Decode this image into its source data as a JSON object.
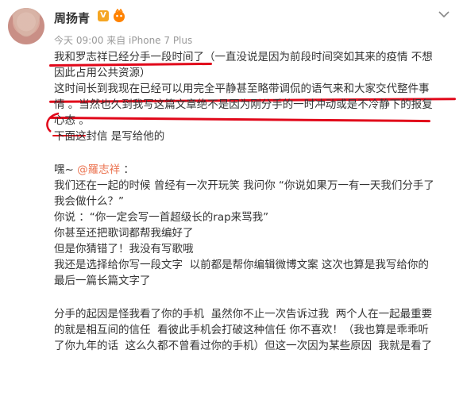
{
  "author": {
    "name": "周扬青",
    "verified_badge": "V",
    "time": "今天 09:00",
    "source": "来自 iPhone 7 Plus"
  },
  "post": {
    "p1_line1": "我和罗志祥已经分手一段时间了（一直没说是因为前段时间突如其来的疫情 不想",
    "p1_line2": "因此占用公共资源）",
    "p2_line1": "这时间长到我现在已经可以用完全平静甚至略带调侃的语气来和大家交代整件事",
    "p2_line2": "情 。当然也久到我写这篇文章绝不是因为刚分手的一时冲动或是不冷静下的报复",
    "p2_line3": "心态 。",
    "p3": "下面这封信 是写给他的",
    "greeting_prefix": "嘿~ ",
    "greeting_mention": "@羅志祥",
    "greeting_suffix": " ：",
    "p4_line1": "我们还在一起的时候 曾经有一次开玩笑 我问你 “你说如果万一有一天我们分手了",
    "p4_line2": "我会做什么？”",
    "p5": "你说 ：“你一定会写一首超级长的rap来骂我”",
    "p6": "你甚至还把歌词都帮我编好了",
    "p7": "但是你猜错了！我没有写歌哦",
    "p8_line1": "我还是选择给你写一段文字  以前都是帮你编辑微博文案 这次也算是我写给你的",
    "p8_line2": "最后一篇长篇文字了",
    "p9_line1": "分手的起因是怪我看了你的手机  虽然你不止一次告诉过我  两个人在一起最重要",
    "p9_line2": "的就是相互间的信任  看彼此手机会打破这种信任 你不喜欢！（我也算是乖乖听",
    "p9_line3": "了你九年的话  这么久都不曾看过你的手机）但这一次因为某些原因  我就是看了"
  },
  "colors": {
    "underline": "#e1081a",
    "mention": "#eb7350",
    "meta": "#999999"
  }
}
